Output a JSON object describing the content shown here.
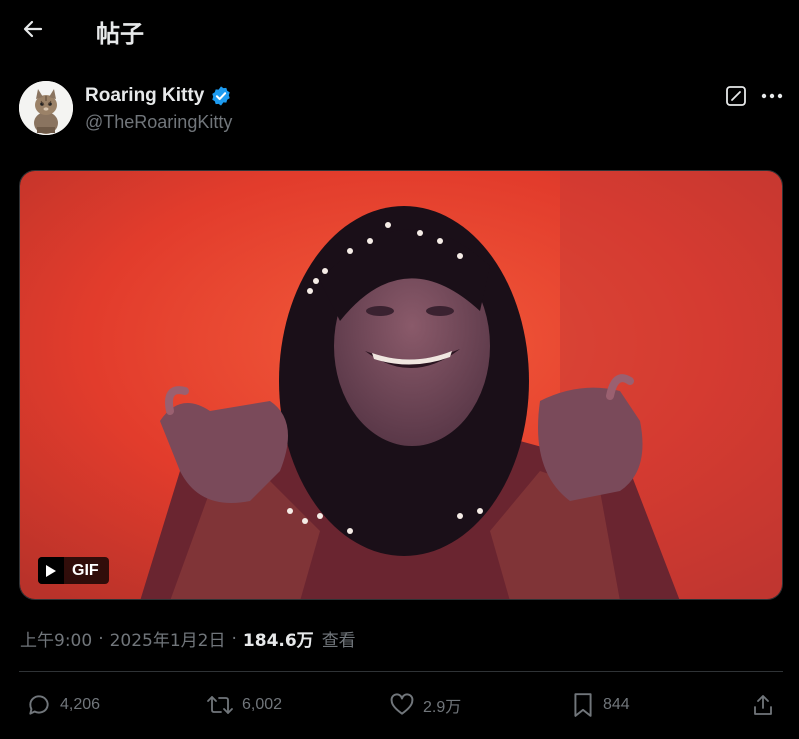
{
  "header": {
    "title": "帖子"
  },
  "post": {
    "author": {
      "name": "Roaring Kitty",
      "handle": "@TheRoaringKitty",
      "verified": true,
      "verified_color": "#1d9bf0"
    },
    "media": {
      "type": "GIF",
      "badge_label": "GIF"
    },
    "meta": {
      "time": "上午9:00",
      "separator": "·",
      "date": "2025年1月2日",
      "views_count": "184.6万",
      "views_label": "查看"
    },
    "actions": {
      "replies": "4,206",
      "reposts": "6,002",
      "likes": "2.9万",
      "bookmarks": "844"
    }
  },
  "colors": {
    "background": "#000000",
    "text_primary": "#e7e9ea",
    "text_secondary": "#71767b",
    "divider": "#2f3336",
    "accent": "#1d9bf0"
  }
}
